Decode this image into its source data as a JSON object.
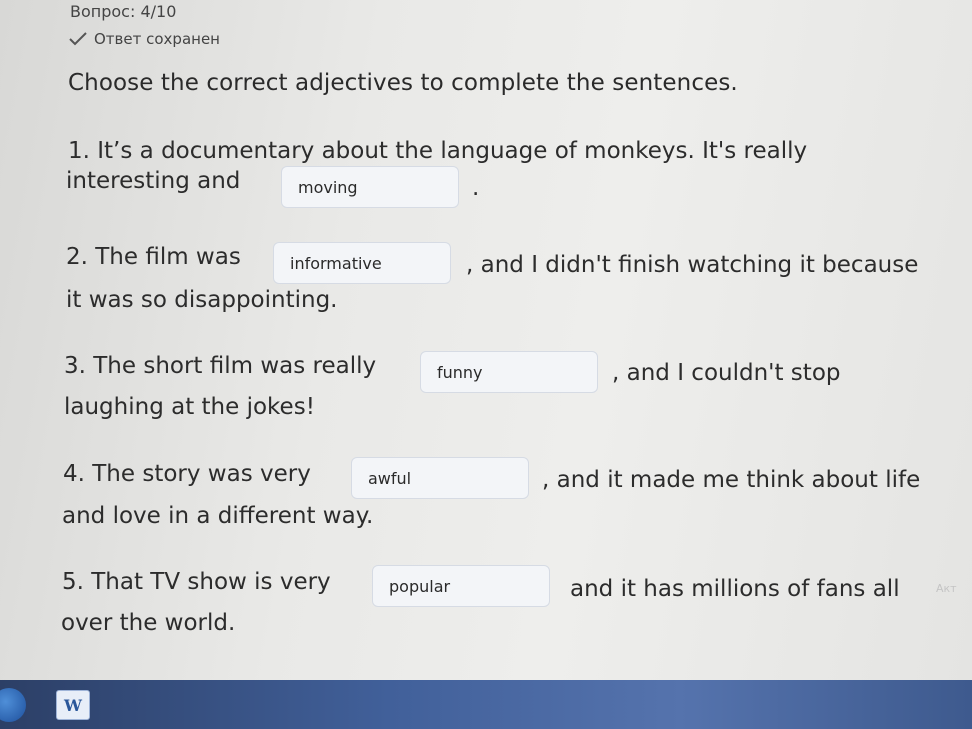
{
  "header": {
    "question_counter": "Вопрос: 4/10",
    "saved_status": "Ответ сохранен"
  },
  "instructions": "Choose the correct adjectives to complete the sentences.",
  "questions": [
    {
      "line1_before": "1. It’s a documentary about the language of monkeys. It's really",
      "line2_before": "interesting and",
      "answer": "moving",
      "after": "."
    },
    {
      "line1_before": "2. The film was",
      "answer": "informative",
      "after": ", and I didn't finish watching it because",
      "line2": "it was so disappointing."
    },
    {
      "line1_before": "3. The short film was really",
      "answer": "funny",
      "after": ", and I couldn't stop",
      "line2": "laughing at the jokes!"
    },
    {
      "line1_before": "4. The story was very",
      "answer": "awful",
      "after": ", and it made me think about life",
      "line2": "and love in a different way."
    },
    {
      "line1_before": "5. That TV show is very",
      "answer": "popular",
      "after": "and it has millions of fans all",
      "line2": "over the world."
    }
  ],
  "taskbar": {
    "word_icon_label": "W"
  },
  "watermark_text": "Акт"
}
